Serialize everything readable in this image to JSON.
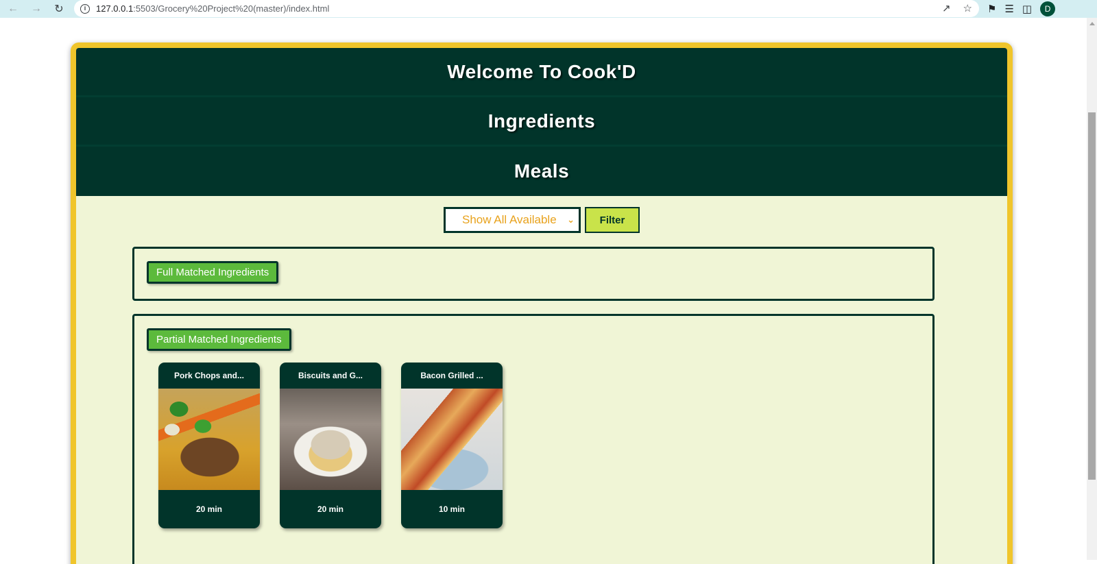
{
  "browser": {
    "url_host": "127.0.0.1",
    "url_rest": ":5503/Grocery%20Project%20(master)/index.html",
    "profile_initial": "D"
  },
  "header": {
    "welcome": "Welcome To Cook'D",
    "ingredients": "Ingredients",
    "meals": "Meals"
  },
  "filter": {
    "selected": "Show All Available",
    "button_label": "Filter"
  },
  "sections": {
    "full_label": "Full Matched Ingredients",
    "partial_label": "Partial Matched Ingredients"
  },
  "meals": [
    {
      "title": "Pork Chops and...",
      "time": "20 min",
      "image": "pork-chops-vegetables"
    },
    {
      "title": "Biscuits and G...",
      "time": "20 min",
      "image": "biscuits-gravy"
    },
    {
      "title": "Bacon Grilled ...",
      "time": "10 min",
      "image": "bacon-grilled-cheese"
    }
  ],
  "colors": {
    "header_bg": "#01342a",
    "page_bg": "#f0f5d6",
    "frame_border": "#f0c52b",
    "label_green": "#5cba3c",
    "filter_btn": "#c9e34a",
    "select_text": "#e8a21c"
  }
}
